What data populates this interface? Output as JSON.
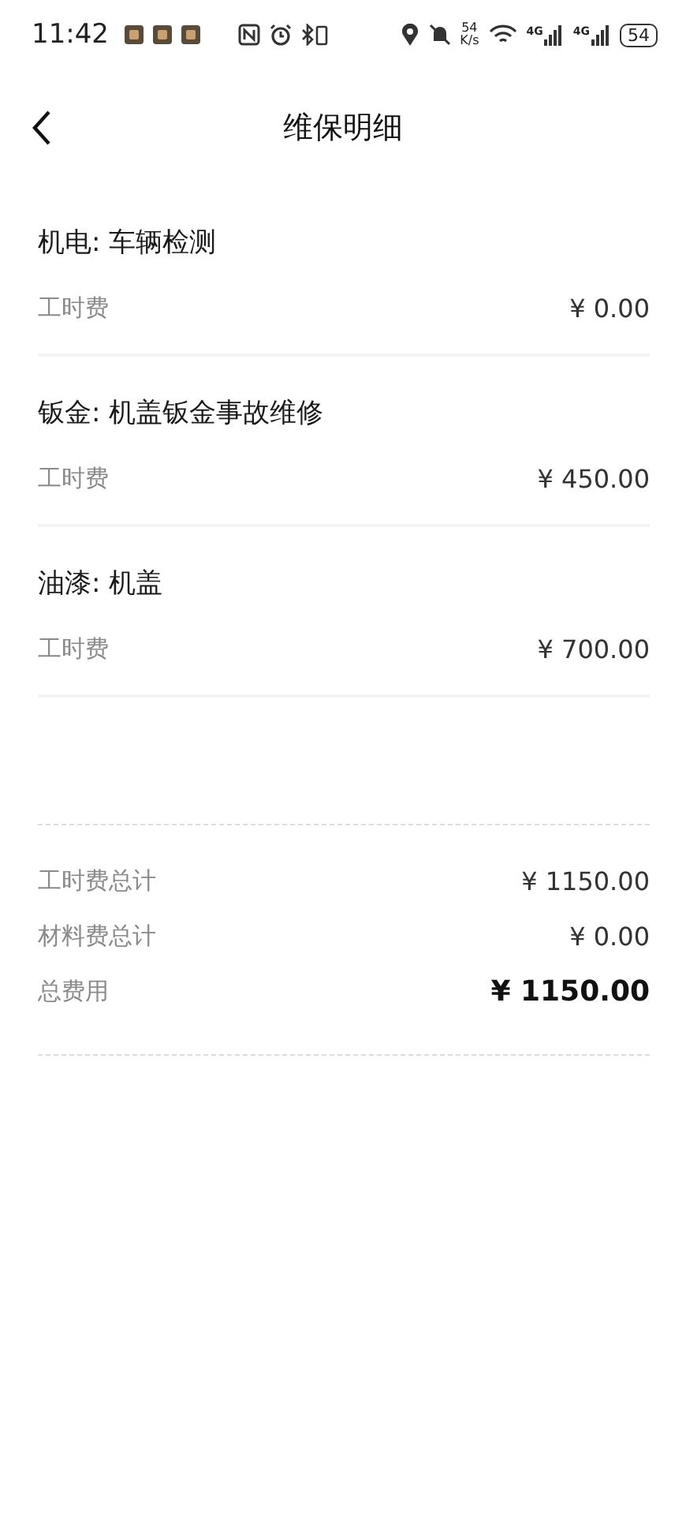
{
  "status_bar": {
    "time": "11:42",
    "speed_value": "54",
    "speed_unit": "K/s",
    "network_1": "4G",
    "network_2": "4G",
    "battery": "54"
  },
  "header": {
    "title": "维保明细"
  },
  "items": [
    {
      "title": "机电: 车辆检测",
      "fee_label": "工时费",
      "fee": "¥ 0.00"
    },
    {
      "title": "钣金: 机盖钣金事故维修",
      "fee_label": "工时费",
      "fee": "¥ 450.00"
    },
    {
      "title": "油漆: 机盖",
      "fee_label": "工时费",
      "fee": "¥ 700.00"
    }
  ],
  "summary": [
    {
      "kind": "normal",
      "label": "工时费总计",
      "value": "¥ 1150.00"
    },
    {
      "kind": "normal",
      "label": "材料费总计",
      "value": "¥ 0.00"
    },
    {
      "kind": "total",
      "label": "总费用",
      "value": "¥ 1150.00"
    }
  ]
}
